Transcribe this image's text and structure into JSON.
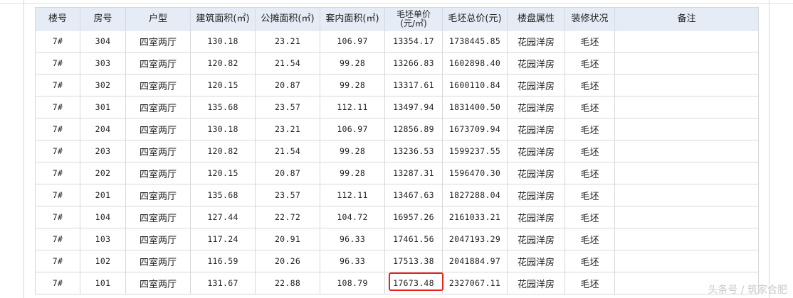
{
  "table": {
    "headers": [
      {
        "key": "building",
        "label": "楼号"
      },
      {
        "key": "room",
        "label": "房号"
      },
      {
        "key": "layout",
        "label": "户型"
      },
      {
        "key": "gross_area",
        "label": "建筑面积(㎡)"
      },
      {
        "key": "shared_area",
        "label": "公摊面积(㎡)"
      },
      {
        "key": "inner_area",
        "label": "套内面积(㎡)"
      },
      {
        "key": "unit_price",
        "label_line1": "毛坯单价",
        "label_line2": "(元/㎡)"
      },
      {
        "key": "total_price",
        "label": "毛坯总价(元)"
      },
      {
        "key": "property_type",
        "label": "楼盘属性"
      },
      {
        "key": "decoration",
        "label": "装修状况"
      },
      {
        "key": "remarks",
        "label": "备注"
      }
    ],
    "rows": [
      {
        "building": "7#",
        "room": "304",
        "layout": "四室两厅",
        "gross_area": "130.18",
        "shared_area": "23.21",
        "inner_area": "106.97",
        "unit_price": "13354.17",
        "total_price": "1738445.85",
        "property_type": "花园洋房",
        "decoration": "毛坯",
        "remarks": ""
      },
      {
        "building": "7#",
        "room": "303",
        "layout": "四室两厅",
        "gross_area": "120.82",
        "shared_area": "21.54",
        "inner_area": "99.28",
        "unit_price": "13266.83",
        "total_price": "1602898.40",
        "property_type": "花园洋房",
        "decoration": "毛坯",
        "remarks": ""
      },
      {
        "building": "7#",
        "room": "302",
        "layout": "四室两厅",
        "gross_area": "120.15",
        "shared_area": "20.87",
        "inner_area": "99.28",
        "unit_price": "13317.61",
        "total_price": "1600110.84",
        "property_type": "花园洋房",
        "decoration": "毛坯",
        "remarks": ""
      },
      {
        "building": "7#",
        "room": "301",
        "layout": "四室两厅",
        "gross_area": "135.68",
        "shared_area": "23.57",
        "inner_area": "112.11",
        "unit_price": "13497.94",
        "total_price": "1831400.50",
        "property_type": "花园洋房",
        "decoration": "毛坯",
        "remarks": ""
      },
      {
        "building": "7#",
        "room": "204",
        "layout": "四室两厅",
        "gross_area": "130.18",
        "shared_area": "23.21",
        "inner_area": "106.97",
        "unit_price": "12856.89",
        "total_price": "1673709.94",
        "property_type": "花园洋房",
        "decoration": "毛坯",
        "remarks": ""
      },
      {
        "building": "7#",
        "room": "203",
        "layout": "四室两厅",
        "gross_area": "120.82",
        "shared_area": "21.54",
        "inner_area": "99.28",
        "unit_price": "13236.53",
        "total_price": "1599237.55",
        "property_type": "花园洋房",
        "decoration": "毛坯",
        "remarks": ""
      },
      {
        "building": "7#",
        "room": "202",
        "layout": "四室两厅",
        "gross_area": "120.15",
        "shared_area": "20.87",
        "inner_area": "99.28",
        "unit_price": "13287.31",
        "total_price": "1596470.30",
        "property_type": "花园洋房",
        "decoration": "毛坯",
        "remarks": ""
      },
      {
        "building": "7#",
        "room": "201",
        "layout": "四室两厅",
        "gross_area": "135.68",
        "shared_area": "23.57",
        "inner_area": "112.11",
        "unit_price": "13467.63",
        "total_price": "1827288.04",
        "property_type": "花园洋房",
        "decoration": "毛坯",
        "remarks": ""
      },
      {
        "building": "7#",
        "room": "104",
        "layout": "四室两厅",
        "gross_area": "127.44",
        "shared_area": "22.72",
        "inner_area": "104.72",
        "unit_price": "16957.26",
        "total_price": "2161033.21",
        "property_type": "花园洋房",
        "decoration": "毛坯",
        "remarks": ""
      },
      {
        "building": "7#",
        "room": "103",
        "layout": "四室两厅",
        "gross_area": "117.24",
        "shared_area": "20.91",
        "inner_area": "96.33",
        "unit_price": "17461.56",
        "total_price": "2047193.29",
        "property_type": "花园洋房",
        "decoration": "毛坯",
        "remarks": ""
      },
      {
        "building": "7#",
        "room": "102",
        "layout": "四室两厅",
        "gross_area": "116.59",
        "shared_area": "20.26",
        "inner_area": "96.33",
        "unit_price": "17513.38",
        "total_price": "2041884.97",
        "property_type": "花园洋房",
        "decoration": "毛坯",
        "remarks": ""
      },
      {
        "building": "7#",
        "room": "101",
        "layout": "四室两厅",
        "gross_area": "131.67",
        "shared_area": "22.88",
        "inner_area": "108.79",
        "unit_price": "17673.48",
        "total_price": "2327067.11",
        "property_type": "花园洋房",
        "decoration": "毛坯",
        "remarks": ""
      }
    ],
    "highlighted_cell": {
      "row": 11,
      "column": "unit_price"
    }
  },
  "watermark": "头条号 / 筑家合肥",
  "colors": {
    "header_bg": "#e6ecf5",
    "border": "#d8d8d8",
    "highlight": "#e8221e",
    "watermark": "#c9c9c9"
  }
}
